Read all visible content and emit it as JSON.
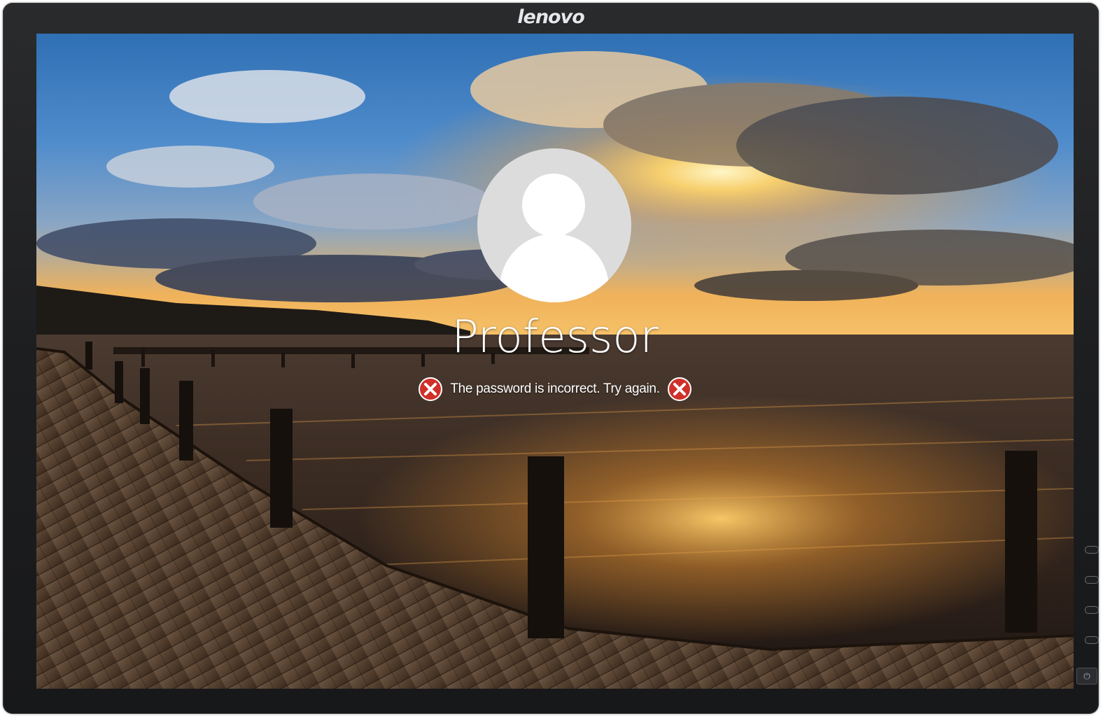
{
  "monitor": {
    "brand": "lenovo"
  },
  "lock_screen": {
    "username": "Professor",
    "error_message": "The password is incorrect. Try again.",
    "error_icon": "error-x-icon",
    "avatar_icon": "default-user-icon"
  },
  "hardware": {
    "power_icon": "power-icon",
    "power_glyph": "⏻"
  },
  "colors": {
    "error_red": "#d0302a",
    "avatar_bg": "#dcdcdc",
    "bezel": "#1d1e20"
  }
}
